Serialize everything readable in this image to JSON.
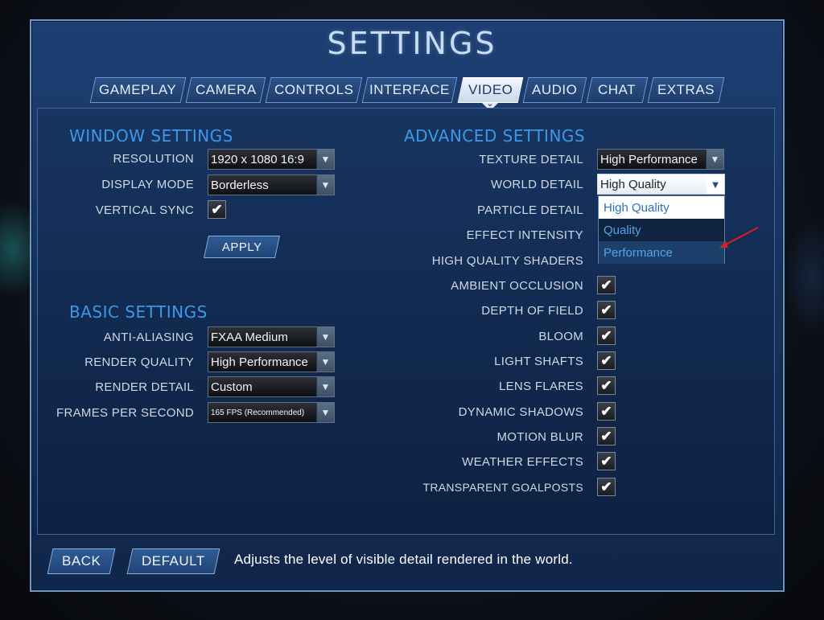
{
  "title": "SETTINGS",
  "tabs": [
    {
      "label": "GAMEPLAY",
      "active": false
    },
    {
      "label": "CAMERA",
      "active": false
    },
    {
      "label": "CONTROLS",
      "active": false
    },
    {
      "label": "INTERFACE",
      "active": false
    },
    {
      "label": "VIDEO",
      "active": true
    },
    {
      "label": "AUDIO",
      "active": false
    },
    {
      "label": "CHAT",
      "active": false
    },
    {
      "label": "EXTRAS",
      "active": false
    }
  ],
  "window_settings": {
    "heading": "WINDOW SETTINGS",
    "resolution": {
      "label": "RESOLUTION",
      "value": "1920 x 1080 16:9"
    },
    "display_mode": {
      "label": "DISPLAY MODE",
      "value": "Borderless"
    },
    "vertical_sync": {
      "label": "VERTICAL SYNC",
      "checked": true
    },
    "apply_label": "APPLY"
  },
  "basic_settings": {
    "heading": "BASIC SETTINGS",
    "anti_aliasing": {
      "label": "ANTI-ALIASING",
      "value": "FXAA Medium"
    },
    "render_quality": {
      "label": "RENDER QUALITY",
      "value": "High Performance"
    },
    "render_detail": {
      "label": "RENDER DETAIL",
      "value": "Custom"
    },
    "fps": {
      "label": "FRAMES PER SECOND",
      "value": "165  FPS (Recommended)"
    }
  },
  "advanced_settings": {
    "heading": "ADVANCED SETTINGS",
    "texture_detail": {
      "label": "TEXTURE DETAIL",
      "value": "High Performance"
    },
    "world_detail": {
      "label": "WORLD DETAIL",
      "value": "High Quality"
    },
    "world_detail_options": [
      "High Quality",
      "Quality",
      "Performance"
    ],
    "particle_detail": {
      "label": "PARTICLE DETAIL"
    },
    "effect_intensity": {
      "label": "EFFECT INTENSITY"
    },
    "high_quality_shaders": {
      "label": "HIGH QUALITY SHADERS"
    },
    "ambient_occlusion": {
      "label": "AMBIENT OCCLUSION",
      "checked": true
    },
    "depth_of_field": {
      "label": "DEPTH OF FIELD",
      "checked": true
    },
    "bloom": {
      "label": "BLOOM",
      "checked": true
    },
    "light_shafts": {
      "label": "LIGHT SHAFTS",
      "checked": true
    },
    "lens_flares": {
      "label": "LENS FLARES",
      "checked": true
    },
    "dynamic_shadows": {
      "label": "DYNAMIC SHADOWS",
      "checked": true
    },
    "motion_blur": {
      "label": "MOTION BLUR",
      "checked": true
    },
    "weather_effects": {
      "label": "WEATHER EFFECTS",
      "checked": true
    },
    "transparent_goalposts": {
      "label": "TRANSPARENT GOALPOSTS",
      "checked": true
    }
  },
  "footer": {
    "back_label": "BACK",
    "default_label": "DEFAULT",
    "description": "Adjusts the level of visible detail rendered in the world."
  },
  "glyphs": {
    "check": "✔",
    "arrow": "▼",
    "chevron": "⌄"
  },
  "colors": {
    "accent": "#3d98e5",
    "panel": "#173561",
    "annotation": "#d92020"
  }
}
